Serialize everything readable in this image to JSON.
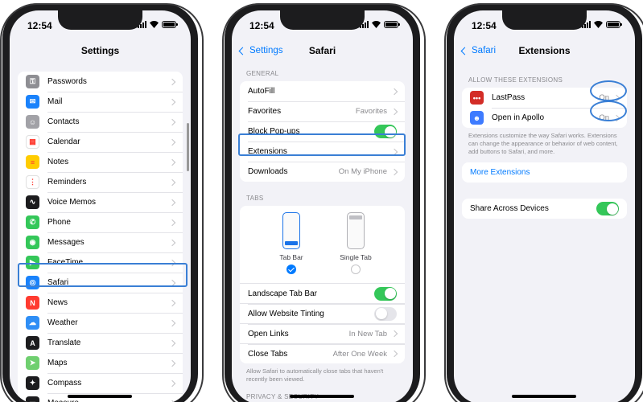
{
  "status": {
    "time": "12:54"
  },
  "phone1": {
    "title": "Settings",
    "items": [
      {
        "label": "Passwords",
        "icon": "key-icon",
        "color": "#8e8e93"
      },
      {
        "label": "Mail",
        "icon": "mail-icon",
        "color": "#1a82fb"
      },
      {
        "label": "Contacts",
        "icon": "contacts-icon",
        "color": "#a2a2a7"
      },
      {
        "label": "Calendar",
        "icon": "calendar-icon",
        "color": "#ffffff"
      },
      {
        "label": "Notes",
        "icon": "notes-icon",
        "color": "#ffcc00"
      },
      {
        "label": "Reminders",
        "icon": "reminders-icon",
        "color": "#ffffff"
      },
      {
        "label": "Voice Memos",
        "icon": "voice-memos-icon",
        "color": "#1c1c1e"
      },
      {
        "label": "Phone",
        "icon": "phone-icon",
        "color": "#34c759"
      },
      {
        "label": "Messages",
        "icon": "messages-icon",
        "color": "#34c759"
      },
      {
        "label": "FaceTime",
        "icon": "facetime-icon",
        "color": "#34c759"
      },
      {
        "label": "Safari",
        "icon": "safari-icon",
        "color": "#1a82fb"
      },
      {
        "label": "News",
        "icon": "news-icon",
        "color": "#ff3b30"
      },
      {
        "label": "Weather",
        "icon": "weather-icon",
        "color": "#2f8ef5"
      },
      {
        "label": "Translate",
        "icon": "translate-icon",
        "color": "#1c1c1e"
      },
      {
        "label": "Maps",
        "icon": "maps-icon",
        "color": "#6fcf6f"
      },
      {
        "label": "Compass",
        "icon": "compass-icon",
        "color": "#1c1c1e"
      },
      {
        "label": "Measure",
        "icon": "measure-icon",
        "color": "#1c1c1e"
      }
    ]
  },
  "phone2": {
    "back": "Settings",
    "title": "Safari",
    "general_header": "GENERAL",
    "general": [
      {
        "label": "AutoFill",
        "value": ""
      },
      {
        "label": "Favorites",
        "value": "Favorites"
      },
      {
        "label": "Block Pop-ups",
        "toggle": "on"
      },
      {
        "label": "Extensions",
        "value": ""
      },
      {
        "label": "Downloads",
        "value": "On My iPhone"
      }
    ],
    "tabs_header": "TABS",
    "tab_bar_label": "Tab Bar",
    "single_tab_label": "Single Tab",
    "tab_rows": [
      {
        "label": "Landscape Tab Bar",
        "toggle": "on"
      },
      {
        "label": "Allow Website Tinting",
        "toggle": "off"
      },
      {
        "label": "Open Links",
        "value": "In New Tab"
      },
      {
        "label": "Close Tabs",
        "value": "After One Week"
      }
    ],
    "tabs_footer": "Allow Safari to automatically close tabs that haven't recently been viewed.",
    "privacy_header": "PRIVACY & SECURITY"
  },
  "phone3": {
    "back": "Safari",
    "title": "Extensions",
    "allow_header": "ALLOW THESE EXTENSIONS",
    "extensions": [
      {
        "label": "LastPass",
        "value": "On",
        "icon": "lastpass-icon",
        "color": "#d32d27"
      },
      {
        "label": "Open in Apollo",
        "value": "On",
        "icon": "apollo-icon",
        "color": "#3e7bff"
      }
    ],
    "footer": "Extensions customize the way Safari works. Extensions can change the appearance or behavior of web content, add buttons to Safari, and more.",
    "more_extensions": "More Extensions",
    "share_label": "Share Across Devices"
  },
  "colors": {
    "accent": "#007aff",
    "highlight": "#3a7fd5",
    "toggle_on": "#34c759"
  }
}
